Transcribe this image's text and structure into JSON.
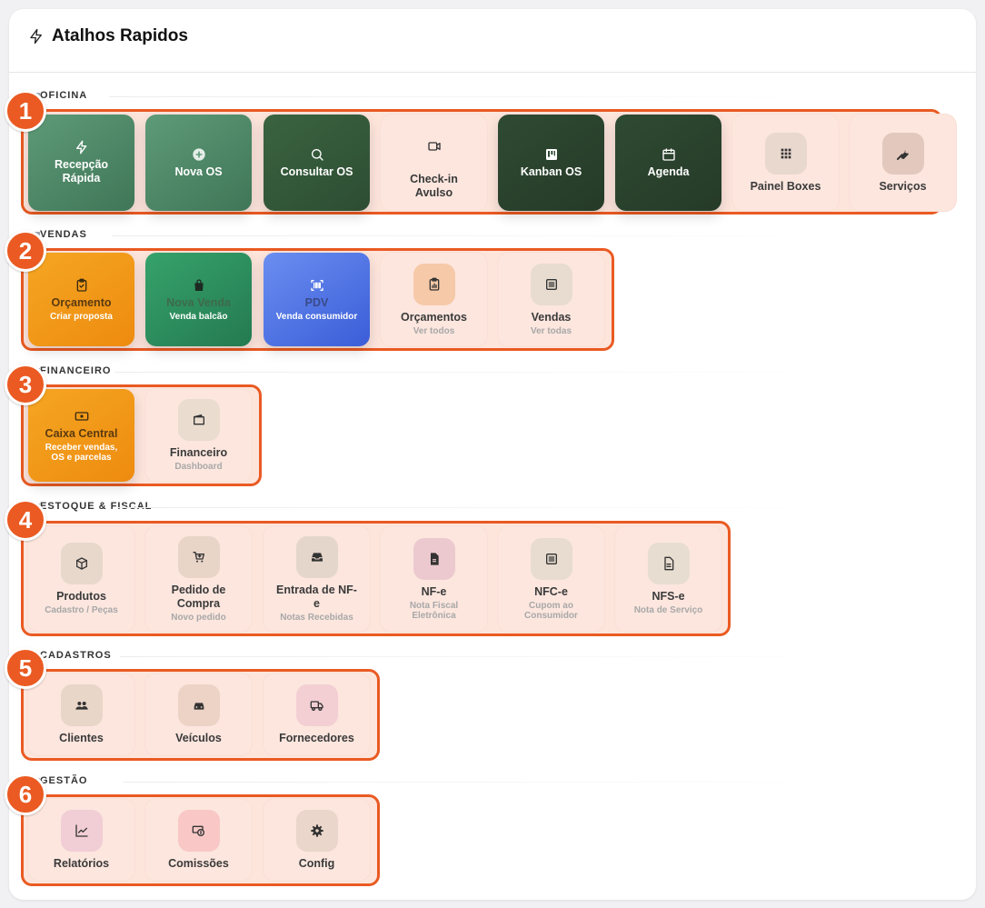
{
  "header": {
    "title": "Atalhos Rapidos",
    "icon": "lightning-icon"
  },
  "sections": [
    {
      "label": "OFICINA",
      "badge": "1",
      "tiles": [
        {
          "title": "Recepção Rápida",
          "icon": "lightning-icon",
          "style": "green-gradient"
        },
        {
          "title": "Nova OS",
          "icon": "plus-circle-icon",
          "style": "green-gradient"
        },
        {
          "title": "Consultar OS",
          "icon": "search-icon",
          "style": "dark-green"
        },
        {
          "title": "Check-in Avulso",
          "icon": "video-icon",
          "style": "light"
        },
        {
          "title": "Kanban OS",
          "icon": "kanban-icon",
          "style": "darkest-green"
        },
        {
          "title": "Agenda",
          "icon": "calendar-icon",
          "style": "darkest-green"
        },
        {
          "title": "Painel Boxes",
          "icon": "grid-icon",
          "style": "light"
        },
        {
          "title": "Serviços",
          "icon": "wrench-icon",
          "style": "light"
        }
      ]
    },
    {
      "label": "VENDAS",
      "badge": "2",
      "tiles": [
        {
          "title": "Orçamento",
          "subtitle": "Criar proposta",
          "icon": "clipboard-check-icon",
          "style": "orange"
        },
        {
          "title": "Nova Venda",
          "subtitle": "Venda balcão",
          "icon": "shopping-bag-icon",
          "style": "green"
        },
        {
          "title": "PDV",
          "subtitle": "Venda consumidor",
          "icon": "barcode-icon",
          "style": "blue"
        },
        {
          "title": "Orçamentos",
          "subtitle": "Ver todos",
          "icon": "clipboard-chart-icon",
          "style": "light"
        },
        {
          "title": "Vendas",
          "subtitle": "Ver todas",
          "icon": "receipt-icon",
          "style": "light"
        }
      ]
    },
    {
      "label": "FINANCEIRO",
      "badge": "3",
      "tiles": [
        {
          "title": "Caixa Central",
          "subtitle": "Receber vendas, OS e parcelas",
          "icon": "cash-register-icon",
          "style": "orange"
        },
        {
          "title": "Financeiro",
          "subtitle": "Dashboard",
          "icon": "wallet-icon",
          "style": "light"
        }
      ]
    },
    {
      "label": "ESTOQUE & FISCAL",
      "badge": "4",
      "tiles": [
        {
          "title": "Produtos",
          "subtitle": "Cadastro / Peças",
          "icon": "box-icon",
          "style": "light"
        },
        {
          "title": "Pedido de Compra",
          "subtitle": "Novo pedido",
          "icon": "cart-plus-icon",
          "style": "light"
        },
        {
          "title": "Entrada de NF-e",
          "subtitle": "Notas Recebidas",
          "icon": "inbox-icon",
          "style": "light"
        },
        {
          "title": "NF-e",
          "subtitle": "Nota Fiscal Eletrônica",
          "icon": "file-icon",
          "style": "light"
        },
        {
          "title": "NFC-e",
          "subtitle": "Cupom ao Consumidor",
          "icon": "receipt-icon",
          "style": "light"
        },
        {
          "title": "NFS-e",
          "subtitle": "Nota de Serviço",
          "icon": "file-text-icon",
          "style": "light"
        }
      ]
    },
    {
      "label": "CADASTROS",
      "badge": "5",
      "tiles": [
        {
          "title": "Clientes",
          "icon": "users-icon",
          "style": "light"
        },
        {
          "title": "Veículos",
          "icon": "car-icon",
          "style": "light"
        },
        {
          "title": "Fornecedores",
          "icon": "truck-icon",
          "style": "light"
        }
      ]
    },
    {
      "label": "GESTÃO",
      "badge": "6",
      "tiles": [
        {
          "title": "Relatórios",
          "icon": "chart-line-icon",
          "style": "light"
        },
        {
          "title": "Comissões",
          "icon": "money-icon",
          "style": "light"
        },
        {
          "title": "Config",
          "icon": "gear-icon",
          "style": "light"
        }
      ]
    }
  ],
  "colors": {
    "accent_orange": "#ea5a22",
    "tile_light": "#fce6de",
    "dark_green": "#2f4a32",
    "green": "#2e8a5c",
    "blue": "#4a6ee0",
    "orange": "#f39a1c"
  }
}
